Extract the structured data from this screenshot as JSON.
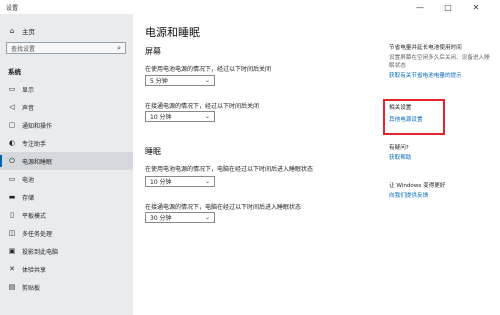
{
  "window": {
    "title": "设置",
    "min_glyph": "—",
    "max_glyph": "□",
    "close_glyph": "✕"
  },
  "sidebar": {
    "home_label": "主页",
    "search_placeholder": "查找设置",
    "section_label": "系统",
    "items": [
      {
        "icon": "display-icon",
        "glyph": "▭",
        "label": "显示"
      },
      {
        "icon": "sound-icon",
        "glyph": "◁",
        "label": "声音"
      },
      {
        "icon": "notification-icon",
        "glyph": "▢",
        "label": "通知和操作"
      },
      {
        "icon": "focus-icon",
        "glyph": "◐",
        "label": "专注助手"
      },
      {
        "icon": "power-icon",
        "glyph": "⏻",
        "label": "电源和睡眠"
      },
      {
        "icon": "battery-icon",
        "glyph": "▭",
        "label": "电池"
      },
      {
        "icon": "storage-icon",
        "glyph": "▬",
        "label": "存储"
      },
      {
        "icon": "tablet-icon",
        "glyph": "▯",
        "label": "平板模式"
      },
      {
        "icon": "multitask-icon",
        "glyph": "◫",
        "label": "多任务处理"
      },
      {
        "icon": "projection-icon",
        "glyph": "▣",
        "label": "投影到此电脑"
      },
      {
        "icon": "shared-experience-icon",
        "glyph": "✕",
        "label": "体验共享"
      },
      {
        "icon": "clipboard-icon",
        "glyph": "▤",
        "label": "剪贴板"
      }
    ]
  },
  "main": {
    "title": "电源和睡眠",
    "screen": {
      "heading": "屏幕",
      "battery_label": "在使用电池电源的情况下，经过以下时间后关闭",
      "battery_value": "5 分钟",
      "plugged_label": "在接通电源的情况下，经过以下时间后关闭",
      "plugged_value": "10 分钟"
    },
    "sleep": {
      "heading": "睡眠",
      "battery_label": "在使用电池电源的情况下，电脑在经过以下时间后进入睡眠状态",
      "battery_value": "10 分钟",
      "plugged_label": "在接通电源的情况下，电脑在经过以下时间后进入睡眠状态",
      "plugged_value": "30 分钟"
    }
  },
  "right_column": {
    "battery_heading": "节省电量并延长电池使用时间",
    "battery_desc_1": "设置屏幕在空闲多久后关闭、设备进入睡",
    "battery_desc_2": "眠状态",
    "battery_link": "获取有关节省电池电量的提示",
    "related_heading": "相关设置",
    "related_link": "其他电源设置",
    "help_heading": "有疑问?",
    "help_link": "获取帮助",
    "improve_heading": "让 Windows 变得更好",
    "improve_link": "向我们提供反馈"
  }
}
